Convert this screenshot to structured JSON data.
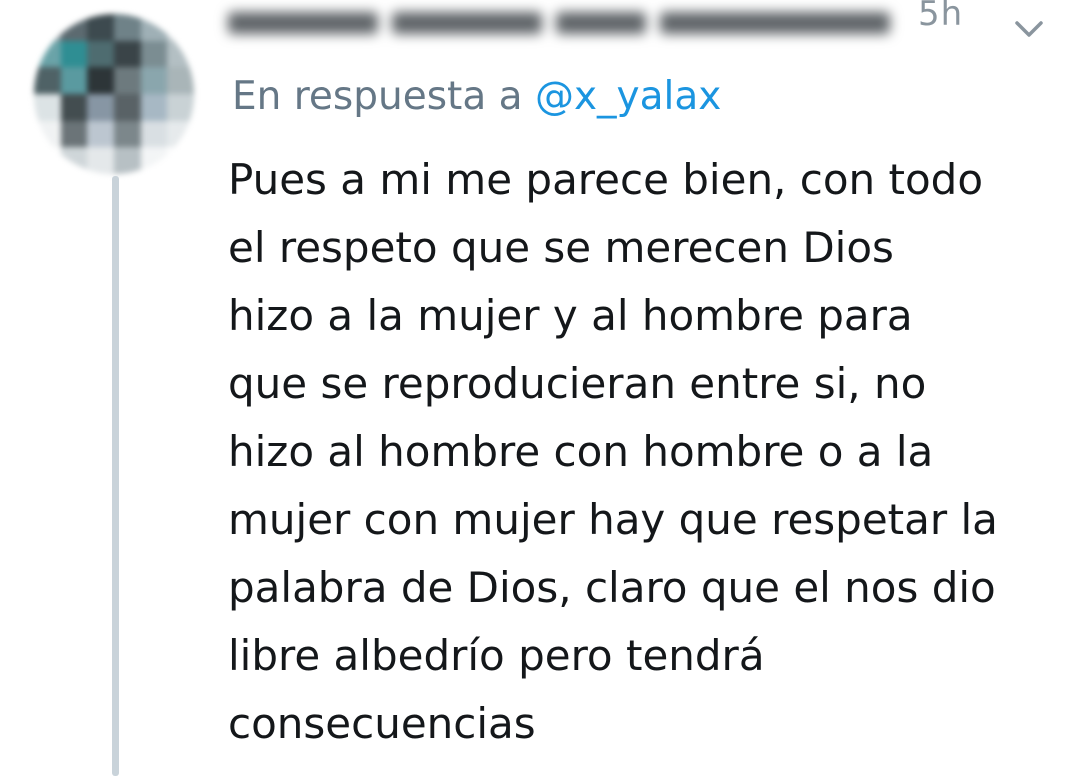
{
  "tweet": {
    "timestamp": "5h",
    "reply_prefix": "En respuesta a",
    "reply_handle": "@x_yalax",
    "text_lines": [
      "Pues a mi me parece bien, con todo",
      "el respeto que se merecen Dios",
      "hizo a la mujer y al hombre para",
      "que se reproducieran entre si, no",
      "hizo al hombre con hombre o a la",
      "mujer con mujer hay que respetar la",
      "palabra de Dios, claro que el nos dio",
      "libre albedrío pero tendrá",
      "consecuencias"
    ]
  },
  "icons": {
    "menu": "chevron-down-icon"
  },
  "colors": {
    "text": "#14171a",
    "secondary": "#657786",
    "link": "#1b95e0",
    "thread_line": "#c9d3da"
  }
}
